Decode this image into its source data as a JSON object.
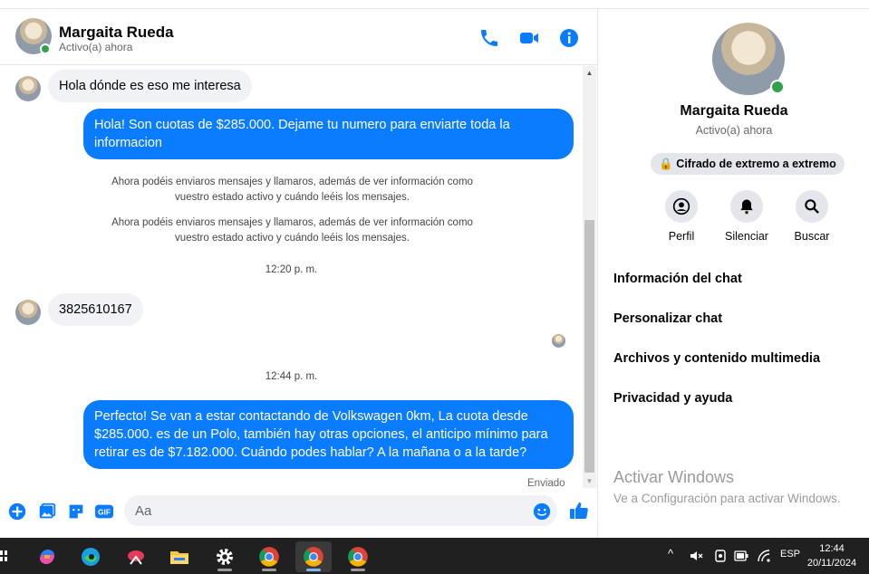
{
  "contact": {
    "name": "Margaita Rueda",
    "status": "Activo(a) ahora"
  },
  "messages": {
    "m1": "Hola dónde es eso me interesa",
    "m2_l1": "Hola! Son cuotas de $285.000. Dejame tu numero para enviarte toda la",
    "m2_l2": "informacion",
    "sys1_l1": "Ahora podéis enviaros mensajes y llamaros, además de ver información como",
    "sys1_l2": "vuestro estado activo y cuándo leéis los mensajes.",
    "sys2_l1": "Ahora podéis enviaros mensajes y llamaros, además de ver información como",
    "sys2_l2": "vuestro estado activo y cuándo leéis los mensajes.",
    "time1": "12:20 p. m.",
    "m3": "3825610167",
    "time2": "12:44 p. m.",
    "m4_l1": "Perfecto!  Se van a estar contactando de Volkswagen 0km, La cuota desde",
    "m4_l2": "$285.000. es de un Polo, también hay otras opciones, el anticipo mínimo para",
    "m4_l3": "retirar es de $7.182.000. Cuándo podes hablar? A la mañana o a la tarde?",
    "sent_label": "Enviado"
  },
  "composer": {
    "placeholder": "Aa"
  },
  "sidebar": {
    "encryption": "🔒 Cifrado de extremo a extremo",
    "actions": {
      "profile": "Perfil",
      "mute": "Silenciar",
      "search": "Buscar"
    },
    "menu": [
      "Información del chat",
      "Personalizar chat",
      "Archivos y contenido multimedia",
      "Privacidad y ayuda"
    ]
  },
  "watermark": {
    "line1": "Activar Windows",
    "line2": "Ve a Configuración para activar Windows."
  },
  "taskbar": {
    "lang": "ESP",
    "time": "12:44",
    "date": "20/11/2024"
  },
  "colors": {
    "accent": "#0a7cff",
    "online": "#31a24c",
    "taskbar": "#202020"
  }
}
